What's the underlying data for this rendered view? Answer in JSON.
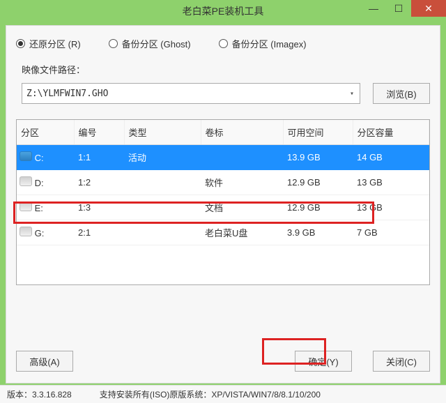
{
  "title": "老白菜PE装机工具",
  "radios": {
    "restore": "还原分区 (R)",
    "backup_ghost": "备份分区 (Ghost)",
    "backup_imagex": "备份分区 (Imagex)",
    "selected": "restore"
  },
  "file": {
    "label": "映像文件路径：",
    "value": "Z:\\YLMFWIN7.GHO",
    "browse_btn": "浏览(B)"
  },
  "table": {
    "headers": [
      "分区",
      "编号",
      "类型",
      "卷标",
      "可用空间",
      "分区容量"
    ],
    "rows": [
      {
        "drive": "C:",
        "id": "1:1",
        "type": "活动",
        "label": "",
        "free": "13.9 GB",
        "size": "14 GB",
        "selected": true
      },
      {
        "drive": "D:",
        "id": "1:2",
        "type": "",
        "label": "软件",
        "free": "12.9 GB",
        "size": "13 GB",
        "selected": false
      },
      {
        "drive": "E:",
        "id": "1:3",
        "type": "",
        "label": "文档",
        "free": "12.9 GB",
        "size": "13 GB",
        "selected": false
      },
      {
        "drive": "G:",
        "id": "2:1",
        "type": "",
        "label": "老白菜U盘",
        "free": "3.9 GB",
        "size": "7 GB",
        "selected": false
      }
    ]
  },
  "buttons": {
    "advanced": "高级(A)",
    "ok": "确定(Y)",
    "close": "关闭(C)"
  },
  "status": {
    "version_label": "版本：",
    "version": "3.3.16.828",
    "support": "支持安装所有(ISO)原版系统：XP/VISTA/WIN7/8/8.1/10/200"
  }
}
